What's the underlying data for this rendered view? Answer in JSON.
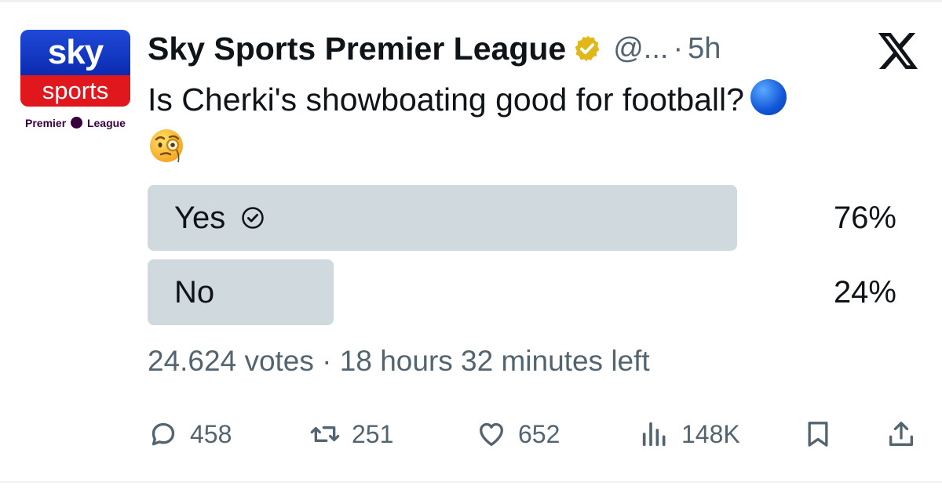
{
  "tweet": {
    "author": {
      "display_name": "Sky Sports Premier League",
      "handle": "@...",
      "verified_badge": "gold-verified-icon",
      "avatar": {
        "brand_top": "sky",
        "brand_bottom": "sports",
        "sub_left": "Premier",
        "sub_right": "League"
      }
    },
    "time": "5h",
    "separator": "·",
    "text": "Is Cherki's showboating good for football?",
    "emojis": [
      "blue-circle-icon",
      "face-with-monocle-icon"
    ],
    "platform_logo": "x-logo-icon"
  },
  "poll": {
    "options": [
      {
        "label": "Yes",
        "percent_text": "76%",
        "percent": 76,
        "selected": true
      },
      {
        "label": "No",
        "percent_text": "24%",
        "percent": 24,
        "selected": false
      }
    ],
    "votes": "24.624 votes",
    "separator": "·",
    "time_left": "18 hours 32 minutes left"
  },
  "actions": {
    "replies": "458",
    "reposts": "251",
    "likes": "652",
    "views": "148K"
  },
  "colors": {
    "poll_bar": "#cfd9de",
    "muted_text": "#536471",
    "verified_gold": "#e2b719",
    "sky_blue": "#0b2bb0",
    "sky_red": "#e1171e"
  }
}
